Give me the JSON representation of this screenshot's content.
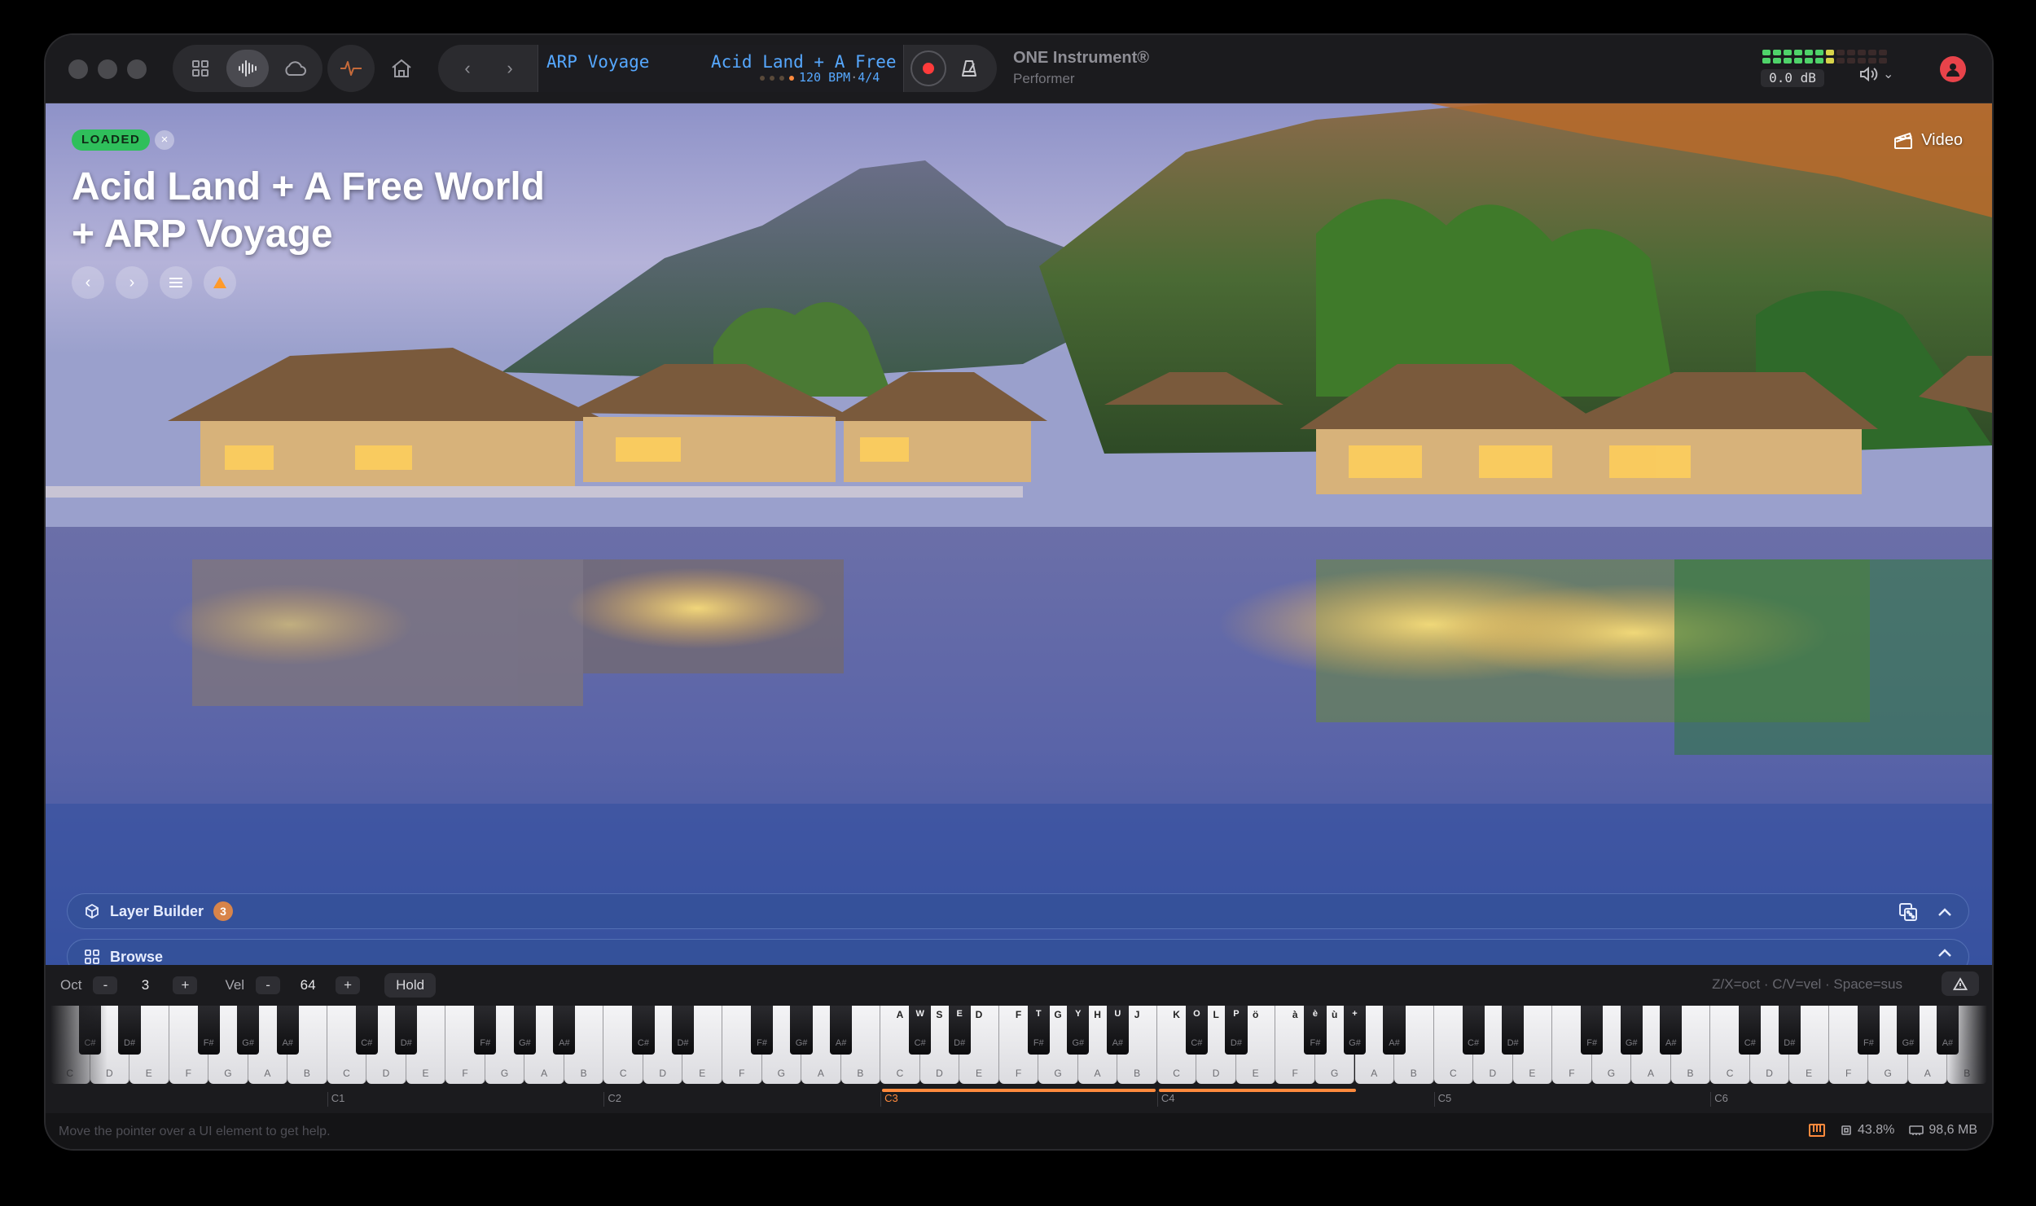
{
  "titlebar": {
    "preset_short": "ARP Voyage",
    "preset_long": "Acid Land + A Free World + ARP Voyage",
    "bpm": "120 BPM",
    "time_sig": "4/4",
    "app_name": "ONE Instrument®",
    "app_mode": "Performer",
    "db_readout": "0.0 dB",
    "icons": [
      "grid-icon",
      "waveform-icon",
      "cloud-icon",
      "pulse-icon",
      "home-icon",
      "chevron-left-icon",
      "chevron-right-icon",
      "record-icon",
      "metronome-icon",
      "speaker-icon",
      "user-icon"
    ]
  },
  "hero": {
    "status_badge": "LOADED",
    "title": "Acid Land + A Free World + ARP Voyage",
    "video_label": "Video"
  },
  "panels": {
    "layer_builder_label": "Layer Builder",
    "layer_count": "3",
    "browse_label": "Browse"
  },
  "keyboard": {
    "oct_label": "Oct",
    "oct_minus": "-",
    "oct_value": "3",
    "oct_plus": "+",
    "vel_label": "Vel",
    "vel_minus": "-",
    "vel_value": "64",
    "vel_plus": "+",
    "hold_label": "Hold",
    "hint": "Z/X=oct · C/V=vel · Space=sus",
    "first_octave": 0,
    "octave_count": 7,
    "highlight_octaves": [
      "C3",
      "C4"
    ],
    "octave_labels": [
      "C1",
      "C2",
      "C3",
      "C4",
      "C5",
      "C6"
    ],
    "active_octave": "C3",
    "mapped_keys": {
      "C3": "A",
      "C#3": "W",
      "D3": "S",
      "D#3": "E",
      "E3": "D",
      "F3": "F",
      "F#3": "T",
      "G3": "G",
      "G#3": "Y",
      "A3": "H",
      "A#3": "U",
      "B3": "J",
      "C4": "K",
      "C#4": "O",
      "D4": "L",
      "D#4": "P",
      "E4": "ö",
      "F4": "à",
      "F#4": "è",
      "G4": "ù",
      "G#4": "+"
    }
  },
  "status": {
    "help": "Move the pointer over a UI element to get help.",
    "cpu": "43.8%",
    "memory": "98,6 MB"
  },
  "colors": {
    "accent": "#ff8a3d",
    "lcd_text": "#56a8ff",
    "loaded_green": "#2fbf5b",
    "record_red": "#ff3b3b"
  }
}
